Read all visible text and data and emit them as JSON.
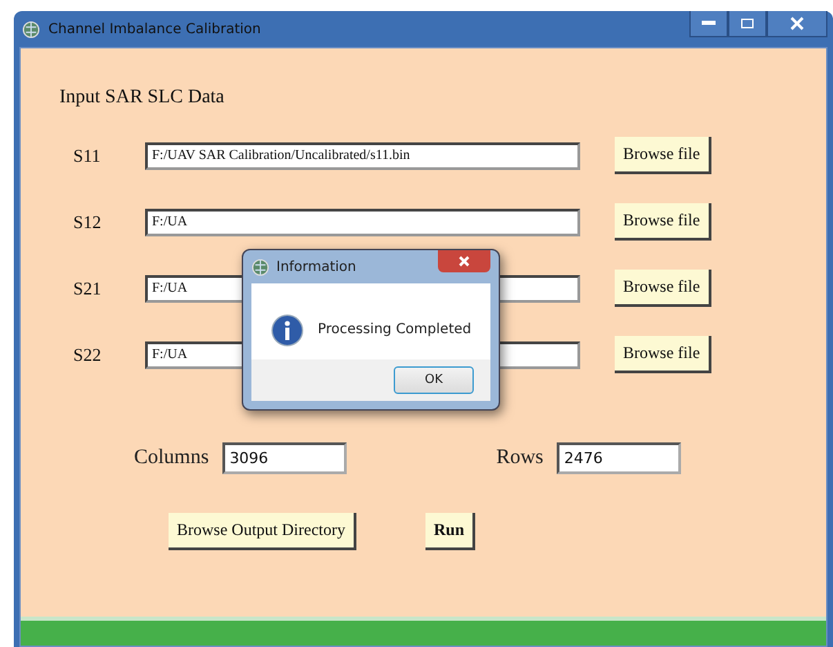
{
  "window": {
    "title": "Channel Imbalance Calibration"
  },
  "section_title": "Input SAR SLC Data",
  "inputs": [
    {
      "label": "S11",
      "value": "F:/UAV SAR Calibration/Uncalibrated/s11.bin",
      "button": "Browse file"
    },
    {
      "label": "S12",
      "value": "F:/UA",
      "button": "Browse file"
    },
    {
      "label": "S21",
      "value": "F:/UA",
      "button": "Browse file"
    },
    {
      "label": "S22",
      "value": "F:/UA",
      "button": "Browse file"
    }
  ],
  "size": {
    "columns_label": "Columns",
    "columns": "3096",
    "rows_label": "Rows",
    "rows": "2476"
  },
  "actions": [
    {
      "kind": "normal",
      "label": "Browse Output Directory"
    },
    {
      "kind": "bold",
      "label": "Run"
    }
  ],
  "progress": {
    "level": 1
  },
  "dialog": {
    "title": "Information",
    "message": "Processing Completed",
    "button": "OK"
  }
}
